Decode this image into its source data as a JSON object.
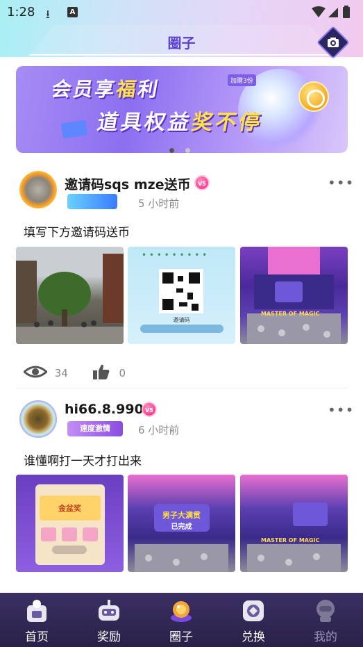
{
  "status_bar": {
    "time": "1:28"
  },
  "header": {
    "title": "圈子"
  },
  "banner": {
    "line1_a": "会员享",
    "line1_b": "福",
    "line1_c": "利",
    "line2_a": "道具权益",
    "line2_b": "奖不停",
    "tag": "加赠3份"
  },
  "posts": [
    {
      "username": "邀请码sqs mze送币",
      "level": "V5",
      "time_ago": "5 小时前",
      "text": "填写下方邀请码送币",
      "views": "34",
      "likes": "0"
    },
    {
      "username": "hi66.8.990",
      "level": "V5",
      "badge": "速度激情",
      "time_ago": "6 小时前",
      "text": "谁懂啊打一天才打出来"
    }
  ],
  "thumb_texts": {
    "qr_caption": "邀请码",
    "machine_title": "MASTER OF MAGIC",
    "prize_gold": "金盆奖",
    "prize_full": "男子大满贯",
    "prize_done": "已完成"
  },
  "bottom_nav": [
    {
      "label": "首页",
      "icon": "home-icon"
    },
    {
      "label": "奖励",
      "icon": "reward-icon"
    },
    {
      "label": "圈子",
      "icon": "circle-icon",
      "active": true
    },
    {
      "label": "兑换",
      "icon": "exchange-icon"
    },
    {
      "label": "我的",
      "icon": "profile-icon"
    }
  ],
  "colors": {
    "accent": "#5a3fd0",
    "nav_bg": "#2a2148",
    "vip_pink": "#ff3f93"
  }
}
